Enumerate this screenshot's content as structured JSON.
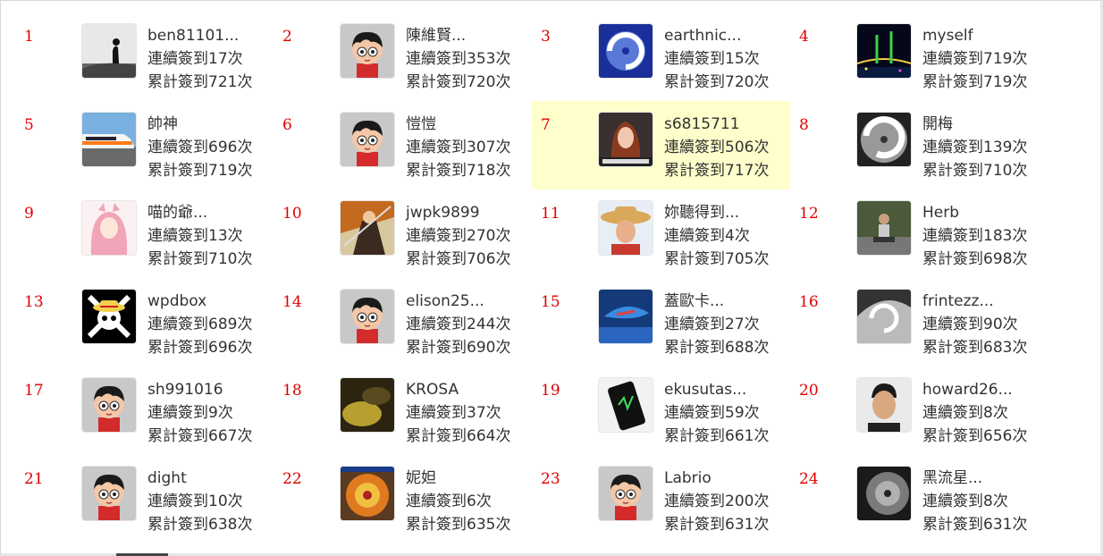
{
  "stats_prefix": {
    "consecutive": "連續簽到",
    "total": "累計簽到",
    "unit": "次"
  },
  "rank_color": "#e00000",
  "highlight_color": "#ffffcc",
  "users": [
    {
      "rank": "1",
      "name": "ben81101...",
      "consecutive": "連續簽到17次",
      "total": "累計簽到721次",
      "avatar": "silhouette-landscape-avatar"
    },
    {
      "rank": "2",
      "name": "陳維賢...",
      "consecutive": "連續簽到353次",
      "total": "累計簽到720次",
      "avatar": "default-cartoon-avatar"
    },
    {
      "rank": "3",
      "name": "earthnic...",
      "consecutive": "連續簽到15次",
      "total": "累計簽到720次",
      "avatar": "typhoon-satellite-avatar"
    },
    {
      "rank": "4",
      "name": "myself",
      "consecutive": "連續簽到719次",
      "total": "累計簽到719次",
      "avatar": "night-bridge-avatar"
    },
    {
      "rank": "5",
      "name": "帥神",
      "consecutive": "連續簽到696次",
      "total": "累計簽到719次",
      "avatar": "high-speed-train-avatar"
    },
    {
      "rank": "6",
      "name": "愷愷",
      "consecutive": "連續簽到307次",
      "total": "累計簽到718次",
      "avatar": "default-cartoon-avatar"
    },
    {
      "rank": "7",
      "name": "s6815711",
      "consecutive": "連續簽到506次",
      "total": "累計簽到717次",
      "avatar": "woman-portrait-avatar",
      "highlight": true
    },
    {
      "rank": "8",
      "name": "開梅",
      "consecutive": "連續簽到139次",
      "total": "累計簽到710次",
      "avatar": "hurricane-bw-avatar"
    },
    {
      "rank": "9",
      "name": "喵的爺...",
      "consecutive": "連續簽到13次",
      "total": "累計簽到710次",
      "avatar": "anime-girl-avatar"
    },
    {
      "rank": "10",
      "name": "jwpk9899",
      "consecutive": "連續簽到270次",
      "total": "累計簽到706次",
      "avatar": "anime-fighter-avatar"
    },
    {
      "rank": "11",
      "name": "妳聽得到...",
      "consecutive": "連續簽到4次",
      "total": "累計簽到705次",
      "avatar": "straw-hat-boy-avatar"
    },
    {
      "rank": "12",
      "name": "Herb",
      "consecutive": "連續簽到183次",
      "total": "累計簽到698次",
      "avatar": "man-outdoors-avatar"
    },
    {
      "rank": "13",
      "name": "wpdbox",
      "consecutive": "連續簽到689次",
      "total": "累計簽到696次",
      "avatar": "straw-hat-jolly-roger-avatar"
    },
    {
      "rank": "14",
      "name": "elison25...",
      "consecutive": "連續簽到244次",
      "total": "累計簽到690次",
      "avatar": "default-cartoon-avatar"
    },
    {
      "rank": "15",
      "name": "蓋歐卡...",
      "consecutive": "連續簽到27次",
      "total": "累計簽到688次",
      "avatar": "sea-creature-avatar"
    },
    {
      "rank": "16",
      "name": "frintezz...",
      "consecutive": "連續簽到90次",
      "total": "累計簽到683次",
      "avatar": "storm-satellite-avatar"
    },
    {
      "rank": "17",
      "name": "sh991016",
      "consecutive": "連續簽到9次",
      "total": "累計簽到667次",
      "avatar": "default-cartoon-avatar"
    },
    {
      "rank": "18",
      "name": "KROSA",
      "consecutive": "連續簽到37次",
      "total": "累計簽到664次",
      "avatar": "dark-yellow-photo-avatar"
    },
    {
      "rank": "19",
      "name": "ekusutas...",
      "consecutive": "連續簽到59次",
      "total": "累計簽到661次",
      "avatar": "smartphone-avatar"
    },
    {
      "rank": "20",
      "name": "howard26...",
      "consecutive": "連續簽到8次",
      "total": "累計簽到656次",
      "avatar": "young-man-avatar"
    },
    {
      "rank": "21",
      "name": "dight",
      "consecutive": "連續簽到10次",
      "total": "累計簽到638次",
      "avatar": "default-cartoon-avatar"
    },
    {
      "rank": "22",
      "name": "妮妲",
      "consecutive": "連續簽到6次",
      "total": "累計簽到635次",
      "avatar": "typhoon-radar-avatar"
    },
    {
      "rank": "23",
      "name": "Labrio",
      "consecutive": "連續簽到200次",
      "total": "累計簽到631次",
      "avatar": "default-cartoon-avatar"
    },
    {
      "rank": "24",
      "name": "黑流星...",
      "consecutive": "連續簽到8次",
      "total": "累計簽到631次",
      "avatar": "typhoon-eye-gray-avatar"
    }
  ]
}
